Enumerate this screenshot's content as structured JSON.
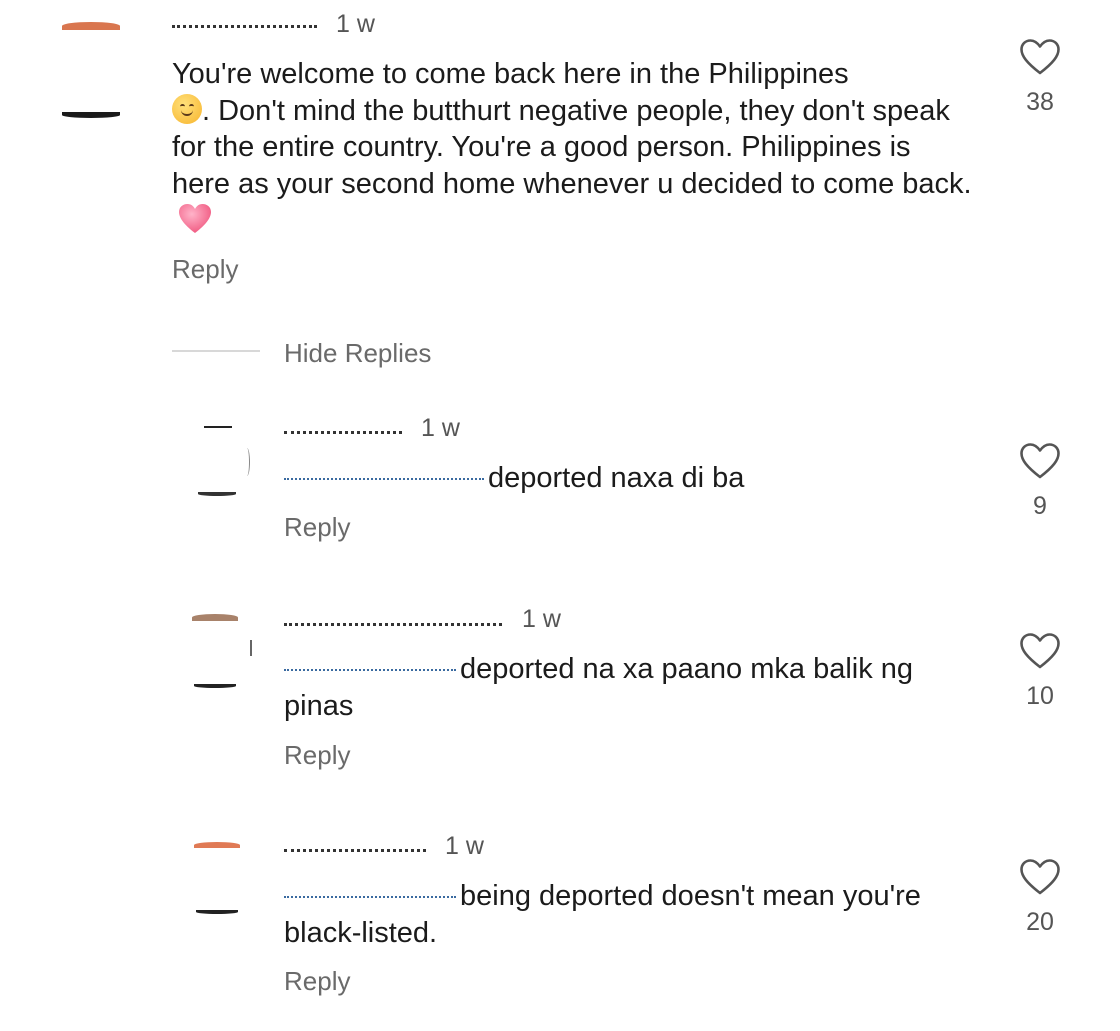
{
  "comments": [
    {
      "username_obscured": true,
      "time": "1 w",
      "text_before_emoji": "You're welcome to come back here in the Philippines",
      "emoji_1": "smiling-face-emoji",
      "text_after_emoji": ". Don't mind the butthurt negative people, they don't speak for the entire country. You're a good person. Philippines is here as your second home whenever u decided to come back.",
      "emoji_2": "pink-heart-emoji",
      "reply_label": "Reply",
      "likes": "38"
    }
  ],
  "hide_replies_label": "Hide Replies",
  "replies": [
    {
      "time": "1 w",
      "text": "deported naxa di ba",
      "reply_label": "Reply",
      "likes": "9"
    },
    {
      "time": "1 w",
      "text_line1": "deported na xa paano mka balik ng",
      "text_line2": "pinas",
      "reply_label": "Reply",
      "likes": "10"
    },
    {
      "time": "1 w",
      "text_line1": "being deported doesn't mean you're",
      "text_line2": "black-listed.",
      "reply_label": "Reply",
      "likes": "20"
    }
  ],
  "colors": {
    "text": "#1b1b1b",
    "secondary": "#6a6a6a",
    "mention": "#3a6aa0",
    "heart_outline": "#555555",
    "heart_emoji": "#f0577f"
  }
}
